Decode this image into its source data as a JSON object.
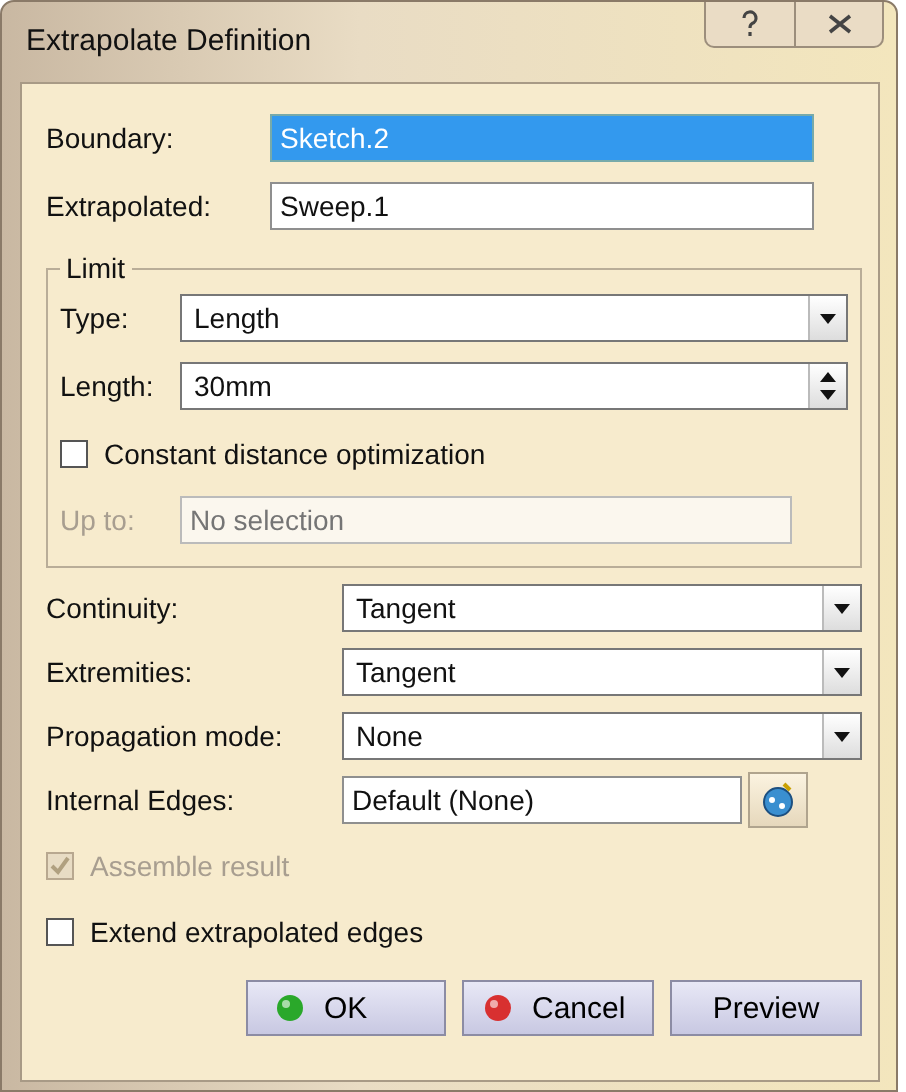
{
  "window": {
    "title": "Extrapolate Definition"
  },
  "fields": [
    {
      "label": "Boundary:",
      "value": "Sketch.2",
      "selected": true
    },
    {
      "label": "Extrapolated:",
      "value": "Sweep.1",
      "selected": false
    }
  ],
  "limit": {
    "title": "Limit",
    "type": {
      "label": "Type:",
      "value": "Length"
    },
    "length": {
      "label": "Length:",
      "value": "30mm"
    },
    "constant_distance": {
      "label": "Constant distance optimization",
      "checked": false
    },
    "up_to": {
      "label": "Up to:",
      "placeholder": "No selection",
      "disabled": true
    }
  },
  "options": [
    {
      "kind": "combo",
      "label": "Continuity:",
      "value": "Tangent"
    },
    {
      "kind": "combo",
      "label": "Extremities:",
      "value": "Tangent"
    },
    {
      "kind": "combo",
      "label": "Propagation mode:",
      "value": "None"
    },
    {
      "kind": "picker",
      "label": "Internal Edges:",
      "value": "Default (None)"
    }
  ],
  "checkboxes": [
    {
      "label": "Assemble result",
      "checked": true,
      "disabled": true
    },
    {
      "label": "Extend extrapolated edges",
      "checked": false,
      "disabled": false
    }
  ],
  "buttons": [
    {
      "label": "OK",
      "kind": "ok"
    },
    {
      "label": "Cancel",
      "kind": "cancel"
    },
    {
      "label": "Preview",
      "kind": "plain"
    }
  ]
}
